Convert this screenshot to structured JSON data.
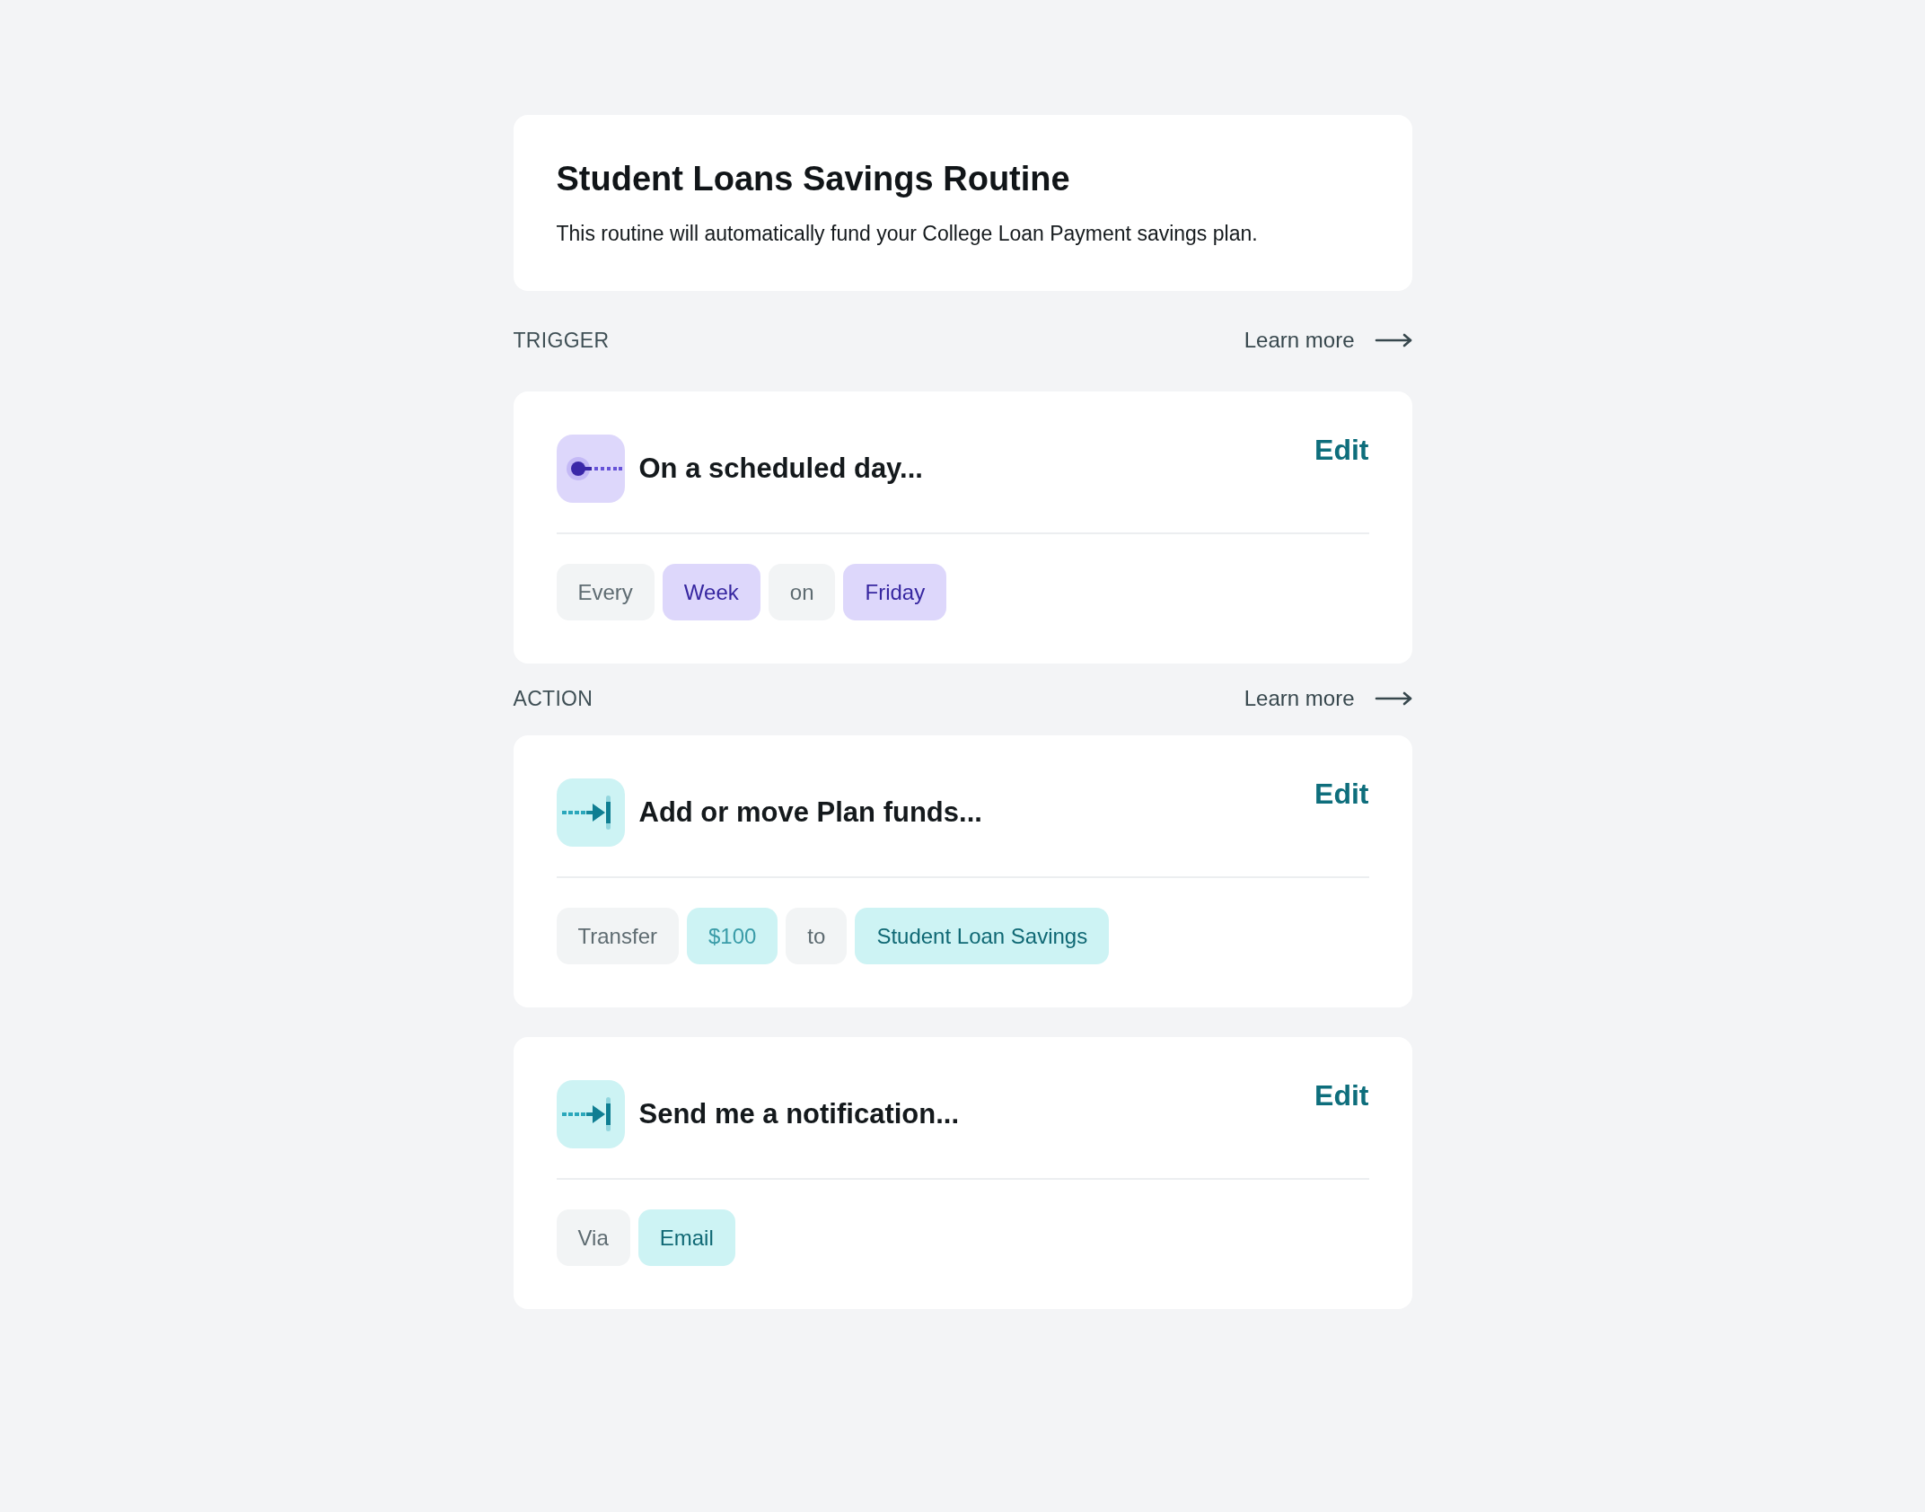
{
  "header": {
    "title": "Student Loans Savings Routine",
    "description": "This routine will automatically fund your College Loan Payment savings plan."
  },
  "sections": [
    {
      "label": "TRIGGER",
      "link": "Learn more",
      "cards": [
        {
          "kind": "schedule",
          "title": "On a scheduled day...",
          "edit": "Edit",
          "chips": [
            {
              "kind": "text",
              "label": "Every"
            },
            {
              "kind": "value",
              "label": "Week"
            },
            {
              "kind": "text",
              "label": "on"
            },
            {
              "kind": "value",
              "label": "Friday"
            }
          ]
        }
      ]
    },
    {
      "label": "ACTION",
      "link": "Learn more",
      "cards": [
        {
          "kind": "action",
          "title": "Add or move Plan funds...",
          "edit": "Edit",
          "chips": [
            {
              "kind": "text",
              "label": "Transfer"
            },
            {
              "kind": "amount",
              "label": "$100"
            },
            {
              "kind": "text",
              "label": "to"
            },
            {
              "kind": "value",
              "label": "Student Loan Savings"
            }
          ]
        },
        {
          "kind": "action",
          "title": "Send me a notification...",
          "edit": "Edit",
          "chips": [
            {
              "kind": "text",
              "label": "Via"
            },
            {
              "kind": "value",
              "label": "Email"
            }
          ]
        }
      ]
    }
  ]
}
